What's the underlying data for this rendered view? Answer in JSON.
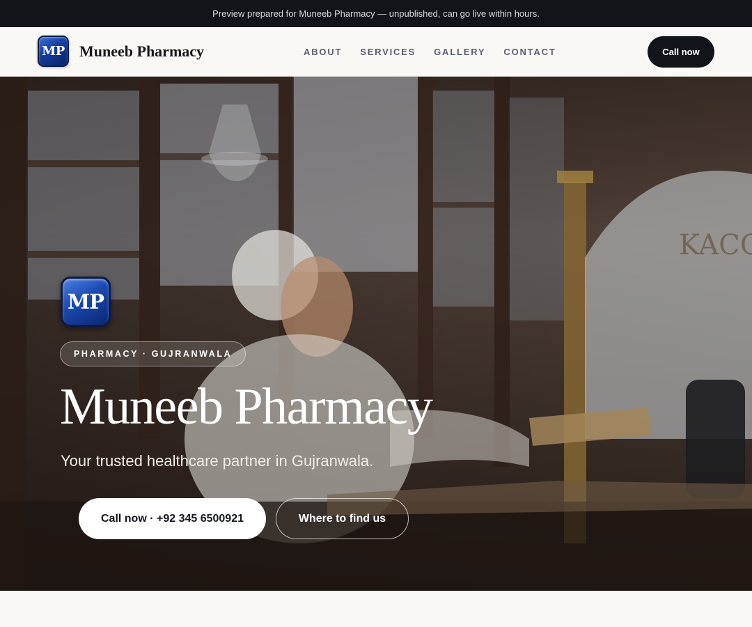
{
  "preview_bar": {
    "text": "Preview prepared for Muneeb Pharmacy — unpublished, can go live within hours."
  },
  "nav": {
    "logo_text": "MP",
    "brand_name": "Muneeb Pharmacy",
    "links": [
      "ABOUT",
      "SERVICES",
      "GALLERY",
      "CONTACT"
    ],
    "cta_label": "Call now"
  },
  "hero": {
    "logo_text": "MP",
    "badge": "PHARMACY · GUJRANWALA",
    "title": "Muneeb Pharmacy",
    "subtitle": "Your trusted healthcare partner in Gujranwala.",
    "primary_button": "Call now · +92 345 6500921",
    "secondary_button": "Where to find us",
    "photo_sign_text": "KACCA"
  },
  "colors": {
    "dark": "#111419",
    "background": "#f9f8f5",
    "logo_blue": "#1a48b0",
    "nav_link": "#5b6070"
  }
}
